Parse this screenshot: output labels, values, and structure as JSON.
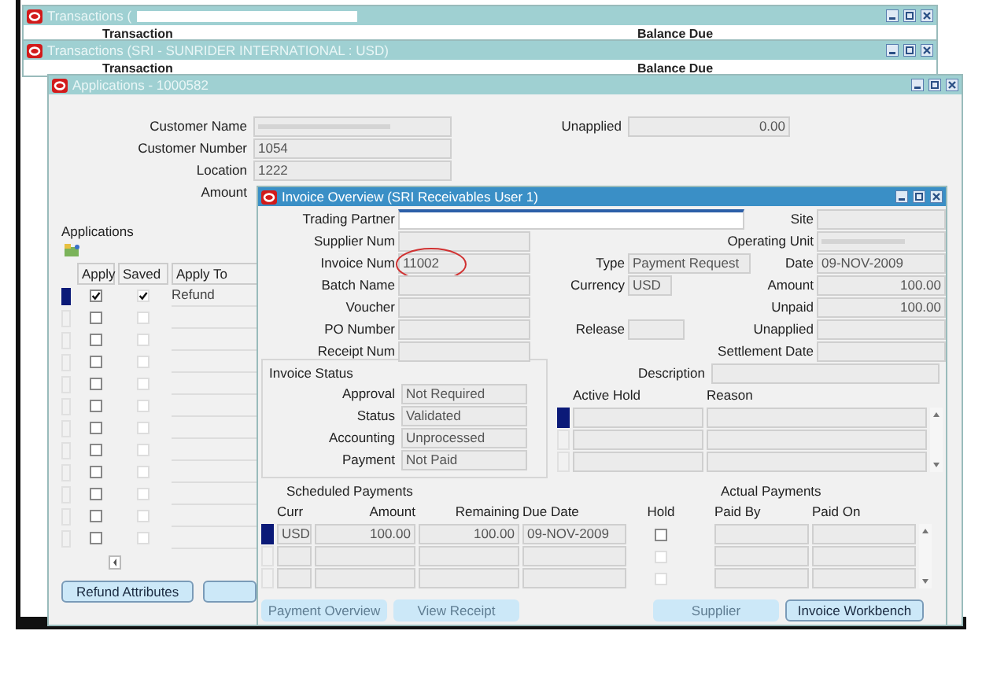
{
  "background_windows": [
    {
      "title": "Transactions (",
      "title_redacted": true,
      "column_labels": [
        "Transaction",
        "Balance Due"
      ]
    },
    {
      "title": "Transactions (SRI - SUNRIDER INTERNATIONAL : USD)",
      "title_redacted": false,
      "column_labels": [
        "Transaction",
        "Balance Due"
      ]
    }
  ],
  "applications_window": {
    "title": "Applications - 1000582",
    "customer_fields": [
      {
        "label": "Customer Name",
        "redacted": true,
        "field_visible": true
      },
      {
        "label": "Customer Number",
        "value": "1054",
        "field_visible": true
      },
      {
        "label": "Location",
        "value": "1222",
        "field_visible": true
      },
      {
        "label": "Amount",
        "field_visible": false
      }
    ],
    "unapplied": {
      "label": "Unapplied",
      "value": "0.00"
    },
    "group_title": "Applications",
    "columns": [
      "Apply",
      "Saved",
      "Apply To"
    ],
    "rows": [
      {
        "apply": true,
        "saved": true,
        "apply_to": "Refund",
        "current": true
      },
      {
        "apply": false,
        "saved": false,
        "current": false
      },
      {
        "apply": false,
        "saved": false,
        "current": false
      },
      {
        "apply": false,
        "saved": false,
        "current": false
      },
      {
        "apply": false,
        "saved": false,
        "current": false
      },
      {
        "apply": false,
        "saved": false,
        "current": false
      },
      {
        "apply": false,
        "saved": false,
        "current": false
      },
      {
        "apply": false,
        "saved": false,
        "current": false
      },
      {
        "apply": false,
        "saved": false,
        "current": false
      },
      {
        "apply": false,
        "saved": false,
        "current": false
      },
      {
        "apply": false,
        "saved": false,
        "current": false
      },
      {
        "apply": false,
        "saved": false,
        "current": false
      }
    ],
    "buttons": [
      "Refund Attributes"
    ]
  },
  "invoice_window": {
    "title": "Invoice Overview (SRI Receivables User 1)",
    "header_rows": [
      {
        "left": {
          "label": "Trading Partner",
          "focused": true
        },
        "right": {
          "label": "Site"
        }
      },
      {
        "left": {
          "label": "Supplier Num"
        },
        "right": {
          "label": "Operating Unit",
          "redacted": true
        }
      },
      {
        "left": {
          "label": "Invoice Num",
          "value": "11002",
          "circled": true
        },
        "middle": {
          "label": "Type",
          "value": "Payment Request"
        },
        "right": {
          "label": "Date",
          "value": "09-NOV-2009"
        }
      },
      {
        "left": {
          "label": "Batch Name"
        },
        "middle": {
          "label": "Currency",
          "value": "USD"
        },
        "right": {
          "label": "Amount",
          "value": "100.00",
          "numeric": true
        }
      },
      {
        "left": {
          "label": "Voucher"
        },
        "right": {
          "label": "Unpaid",
          "value": "100.00",
          "numeric": true
        }
      },
      {
        "left": {
          "label": "PO Number"
        },
        "middle": {
          "label": "Release"
        },
        "right": {
          "label": "Unapplied"
        }
      },
      {
        "left": {
          "label": "Receipt Num"
        },
        "right": {
          "label": "Settlement Date"
        }
      }
    ],
    "description_label": "Description",
    "status_group": {
      "title": "Invoice Status",
      "fields": [
        {
          "label": "Approval",
          "value": "Not Required"
        },
        {
          "label": "Status",
          "value": "Validated"
        },
        {
          "label": "Accounting",
          "value": "Unprocessed"
        },
        {
          "label": "Payment",
          "value": "Not Paid"
        }
      ]
    },
    "holds": {
      "columns": [
        "Active Hold",
        "Reason"
      ],
      "rows": [
        {
          "current": true
        },
        {
          "current": false
        },
        {
          "current": false
        }
      ]
    },
    "scheduled_payments": {
      "title": "Scheduled Payments",
      "columns": [
        "Curr",
        "Amount",
        "Remaining",
        "Due Date",
        "Hold"
      ],
      "rows": [
        {
          "curr": "USD",
          "amount": "100.00",
          "remaining": "100.00",
          "due_date": "09-NOV-2009",
          "hold": false,
          "hold_disabled": false,
          "current": true
        },
        {
          "hold": false,
          "hold_disabled": true,
          "current": false
        },
        {
          "hold": false,
          "hold_disabled": true,
          "current": false
        }
      ]
    },
    "actual_payments": {
      "title": "Actual Payments",
      "columns": [
        "Paid By",
        "Paid On"
      ]
    },
    "buttons": [
      {
        "label": "Payment Overview",
        "disabled": true
      },
      {
        "label": "View Receipt",
        "disabled": true
      },
      {
        "label": "Supplier",
        "disabled": true
      },
      {
        "label": "Invoice Workbench",
        "disabled": false
      }
    ]
  }
}
